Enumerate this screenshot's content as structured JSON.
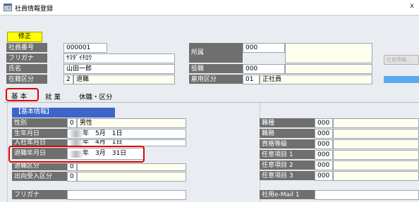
{
  "window": {
    "title": "社員情報登録",
    "close": "x"
  },
  "toolbar": {
    "modify_label": "修正"
  },
  "header": {
    "left_rows": [
      {
        "label": "社員番号",
        "value": "000001"
      },
      {
        "label": "フリガナ",
        "value": "ﾔﾏﾀﾞｲﾁﾛｳ"
      },
      {
        "label": "氏名",
        "value": "山田一郎"
      },
      {
        "label": "在籍区分",
        "code": "2",
        "value": "退職"
      }
    ],
    "affiliation": {
      "label": "所属",
      "value": "000"
    },
    "position": {
      "label": "役職",
      "value": "000"
    },
    "employment": {
      "label": "雇用区分",
      "code": "01",
      "value": "正社員"
    },
    "side_button_text": "社員情報..."
  },
  "tabs": [
    {
      "label": "基 本"
    },
    {
      "label": "就 業"
    },
    {
      "label": "休職・区分"
    }
  ],
  "basic": {
    "section_title": "【基本情報】",
    "rows": [
      {
        "label": "性別",
        "code": "0",
        "value": "男性"
      },
      {
        "label": "生年月日",
        "value": "年　5月　1日"
      },
      {
        "label": "入社年月日",
        "value": "年　4月　1日"
      },
      {
        "label": "退職年月日",
        "value": "年　3月　31日"
      },
      {
        "label": "退職区分",
        "code": "0",
        "value": ""
      },
      {
        "label": "出向受入区分",
        "code": "0",
        "value": ""
      }
    ],
    "furigana_label": "フリガナ"
  },
  "right_panel": {
    "rows": [
      {
        "label": "職種",
        "value": "000"
      },
      {
        "label": "職務",
        "value": "000"
      },
      {
        "label": "資格等級",
        "value": "000"
      },
      {
        "label": "任意項目 1",
        "value": "000"
      },
      {
        "label": "任意項目 2",
        "value": "000"
      },
      {
        "label": "任意項目 3",
        "value": "000"
      }
    ],
    "email_label": "社用e-Mail 1"
  }
}
